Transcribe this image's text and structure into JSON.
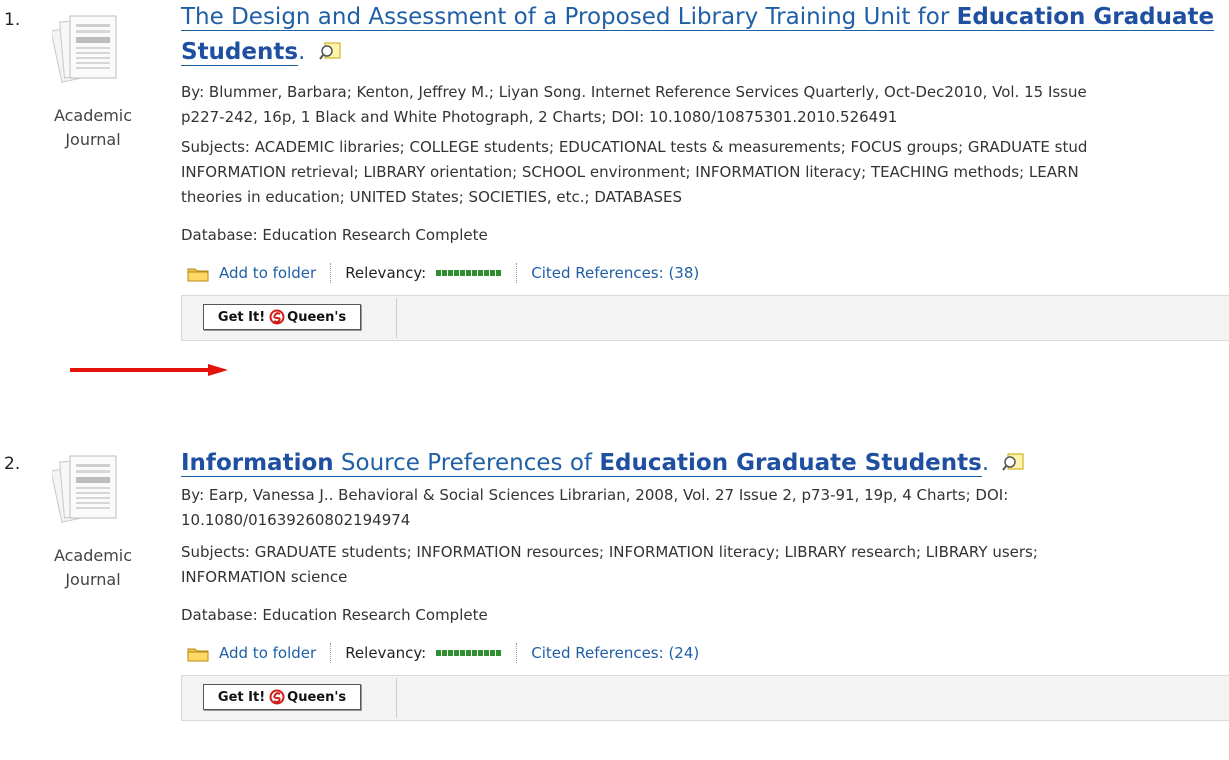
{
  "results": [
    {
      "number": "1.",
      "doc_type_line1": "Academic",
      "doc_type_line2": "Journal",
      "title_part1": "The Design and Assessment of a Proposed Library Training Unit for ",
      "title_bold1": "Education Graduate",
      "title_bold2": "Students",
      "title_end": ".",
      "by_line1": "By: Blummer, Barbara; Kenton, Jeffrey M.; Liyan Song. Internet Reference Services Quarterly, Oct-Dec2010, Vol. 15 Issue",
      "by_line2": "p227-242, 16p, 1 Black and White Photograph, 2 Charts; DOI: 10.1080/10875301.2010.526491",
      "subjects_line1": "Subjects: ACADEMIC libraries; COLLEGE students; EDUCATIONAL tests & measurements; FOCUS groups; GRADUATE stud",
      "subjects_line2": "INFORMATION retrieval; LIBRARY orientation; SCHOOL environment; INFORMATION literacy; TEACHING methods; LEARN",
      "subjects_line3": "theories in education; UNITED States; SOCIETIES, etc.; DATABASES",
      "database": "Database: Education Research Complete",
      "add_to_folder": "Add to folder",
      "relevancy_label": "Relevancy:",
      "relevancy_level": 1.0,
      "cited_refs": "Cited References: (38)",
      "getit_prefix": "Get It!",
      "getit_org": "Queen's"
    },
    {
      "number": "2.",
      "doc_type_line1": "Academic",
      "doc_type_line2": "Journal",
      "title_bold_a": "Information",
      "title_mid": " Source Preferences of ",
      "title_bold_b": "Education Graduate Students",
      "title_end": ".",
      "by_line1": "By: Earp, Vanessa J.. Behavioral & Social Sciences Librarian, 2008, Vol. 27 Issue 2, p73-91, 19p, 4 Charts; DOI:",
      "by_line2": "10.1080/01639260802194974",
      "subjects_line1": "Subjects: GRADUATE students; INFORMATION resources; INFORMATION literacy; LIBRARY research; LIBRARY users;",
      "subjects_line2": "INFORMATION science",
      "database": "Database: Education Research Complete",
      "add_to_folder": "Add to folder",
      "relevancy_label": "Relevancy:",
      "relevancy_level": 1.0,
      "cited_refs": "Cited References: (24)",
      "getit_prefix": "Get It!",
      "getit_org": "Queen's"
    }
  ],
  "colors": {
    "link": "#1f5fa6",
    "relevancy": "#2f8f2f",
    "arrow": "#e3120b"
  }
}
